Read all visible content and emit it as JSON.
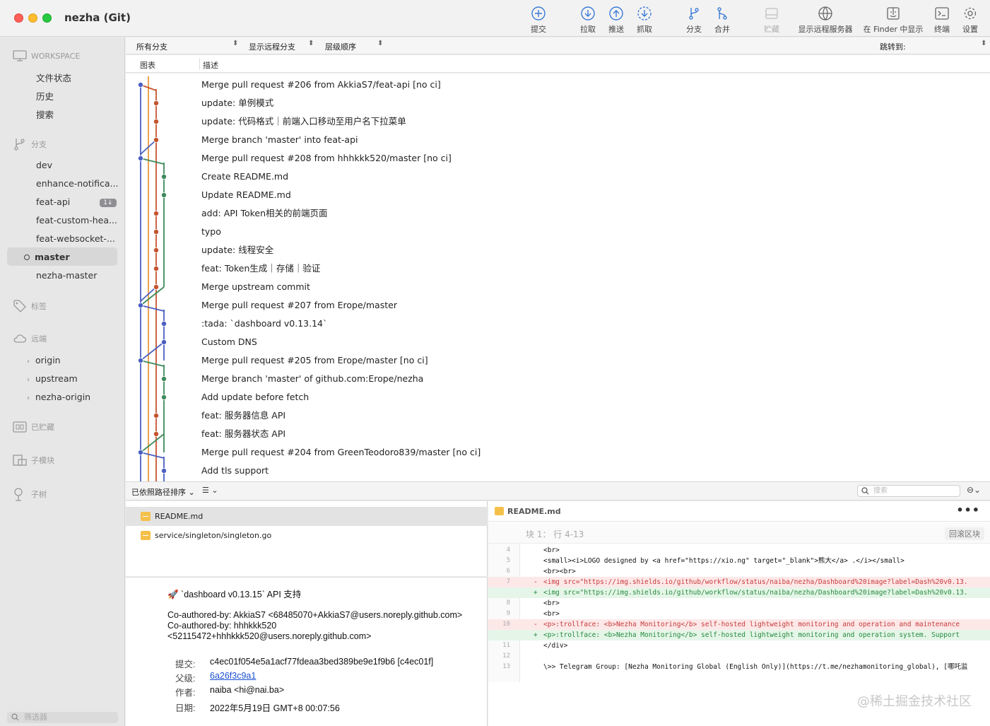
{
  "window": {
    "title": "nezha (Git)"
  },
  "toolbar": {
    "commit": "提交",
    "pull": "拉取",
    "push": "推送",
    "fetch": "抓取",
    "branch": "分支",
    "merge": "合并",
    "stash": "贮藏",
    "remote": "显示远程服务器",
    "finder": "在 Finder 中显示",
    "terminal": "终端",
    "settings": "设置"
  },
  "sidebar": {
    "workspace": "WORKSPACE",
    "workspace_items": [
      "文件状态",
      "历史",
      "搜索"
    ],
    "branches_label": "分支",
    "branches": [
      "dev",
      "enhance-notifica...",
      "feat-api",
      "feat-custom-hea...",
      "feat-websocket-...",
      "master",
      "nezha-master"
    ],
    "feat_api_badge": "1↓",
    "tags_label": "标签",
    "remotes_label": "远端",
    "remotes": [
      "origin",
      "upstream",
      "nezha-origin"
    ],
    "stashes_label": "已贮藏",
    "submodules_label": "子模块",
    "subtrees_label": "子树",
    "filter_placeholder": "筛选器"
  },
  "filterbar": {
    "branches": "所有分支",
    "remote": "显示远程分支",
    "order": "层级顺序",
    "jump": "跳转到:"
  },
  "columns": {
    "graph": "图表",
    "description": "描述"
  },
  "commits": [
    "Merge pull request #206 from AkkiaS7/feat-api [no ci]",
    "update: 单例模式",
    "update: 代码格式｜前端入口移动至用户名下拉菜单",
    "Merge branch 'master' into feat-api",
    "Merge pull request #208 from hhhkkk520/master [no ci]",
    "Create README.md",
    "Update README.md",
    "add: API Token相关的前端页面",
    "typo",
    "update: 线程安全",
    "feat: Token生成｜存储｜验证",
    "Merge upstream commit",
    "Merge pull request #207 from Erope/master",
    ":tada: `dashboard v0.13.14`",
    "Custom DNS",
    "Merge pull request #205 from Erope/master [no ci]",
    "Merge branch 'master' of github.com:Erope/nezha",
    "Add update before fetch",
    "feat: 服务器信息 API",
    "feat: 服务器状态 API",
    "Merge pull request #204 from GreenTeodoro839/master [no ci]",
    "Add tls support"
  ],
  "midbar": {
    "sort": "已依照路径排序",
    "search_placeholder": "搜索"
  },
  "files": [
    "README.md",
    "service/singleton/singleton.go"
  ],
  "details": {
    "title": "🚀 `dashboard v0.13.15` API 支持",
    "body_lines": [
      "Co-authored-by: AkkiaS7 <68485070+AkkiaS7@users.noreply.github.com>",
      "Co-authored-by: hhhkkk520",
      "<52115472+hhhkkk520@users.noreply.github.com>"
    ],
    "commit_label": "提交:",
    "commit_value": "c4ec01f054e5a1acf77fdeaa3bed389be9e1f9b6 [c4ec01f]",
    "parent_label": "父级:",
    "parent_value": "6a26f3c9a1",
    "author_label": "作者:",
    "author_value": "naiba <hi@nai.ba>",
    "date_label": "日期:",
    "date_value": "2022年5月19日 GMT+8 00:07:56"
  },
  "diff": {
    "file": "README.md",
    "hunk_label": "块 1： 行 4-13",
    "hunk_button": "回滚区块",
    "lines": [
      {
        "n": "4",
        "t": "ctx",
        "m": "",
        "code": "  <br>"
      },
      {
        "n": "5",
        "t": "ctx",
        "m": "",
        "code": "  <small><i>LOGO designed by <a href=\"https://xio.ng\" target=\"_blank\">熊大</a> .</i></small>"
      },
      {
        "n": "6",
        "t": "ctx",
        "m": "",
        "code": "  <br><br>"
      },
      {
        "n": "7",
        "t": "del",
        "m": "-",
        "code": "<img src=\"https://img.shields.io/github/workflow/status/naiba/nezha/Dashboard%20image?label=Dash%20v0.13."
      },
      {
        "n": "",
        "t": "add",
        "m": "+",
        "code": "<img src=\"https://img.shields.io/github/workflow/status/naiba/nezha/Dashboard%20image?label=Dash%20v0.13."
      },
      {
        "n": "8",
        "t": "ctx",
        "m": "",
        "code": "  <br>"
      },
      {
        "n": "9",
        "t": "ctx",
        "m": "",
        "code": "  <br>"
      },
      {
        "n": "10",
        "t": "del",
        "m": "-",
        "code": "  <p>:trollface: <b>Nezha Monitoring</b> self-hosted lightweight monitoring and operation and maintenance"
      },
      {
        "n": "",
        "t": "add",
        "m": "+",
        "code": "  <p>:trollface: <b>Nezha Monitoring</b> self-hosted lightweight monitoring and operation system. Support"
      },
      {
        "n": "11",
        "t": "ctx",
        "m": "",
        "code": "</div>"
      },
      {
        "n": "12",
        "t": "ctx",
        "m": "",
        "code": ""
      },
      {
        "n": "13",
        "t": "ctx",
        "m": "",
        "code": "\\>> Telegram Group: [Nezha Monitoring Global (English Only)](https://t.me/nezhamonitoring_global), [哪吒监"
      }
    ]
  },
  "watermark": "@稀土掘金技术社区",
  "colors": {
    "lane_blue": "#4a5fc1",
    "lane_orange": "#e89a3c",
    "lane_red": "#c4552f",
    "lane_green": "#3f8a5c"
  }
}
